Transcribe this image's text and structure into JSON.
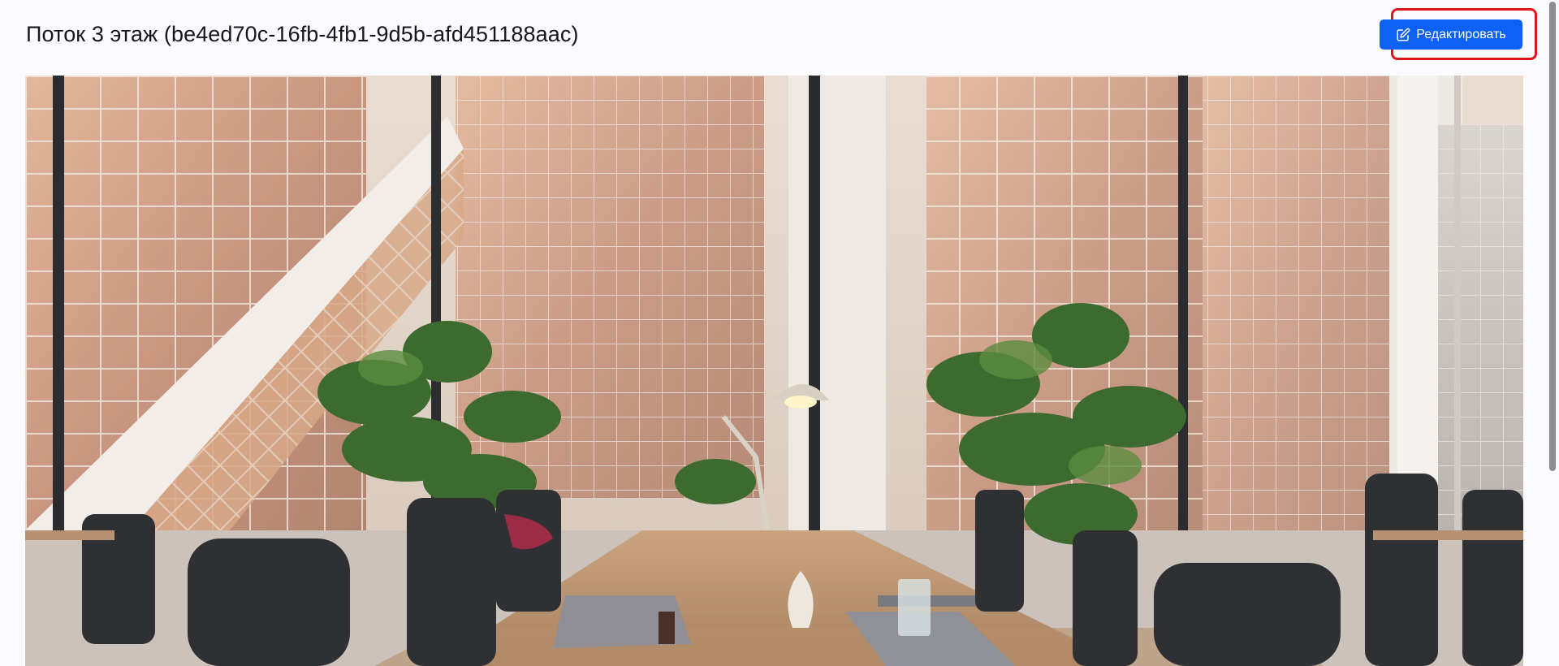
{
  "header": {
    "title": "Поток 3 этаж (be4ed70c-16fb-4fb1-9d5b-afd451188aac)",
    "edit_label": "Редактировать"
  },
  "photo": {
    "description_icon": "office-interior-photo"
  },
  "colors": {
    "accent": "#0d62f5",
    "highlight": "#e0121c",
    "background": "#fbfbfd"
  }
}
